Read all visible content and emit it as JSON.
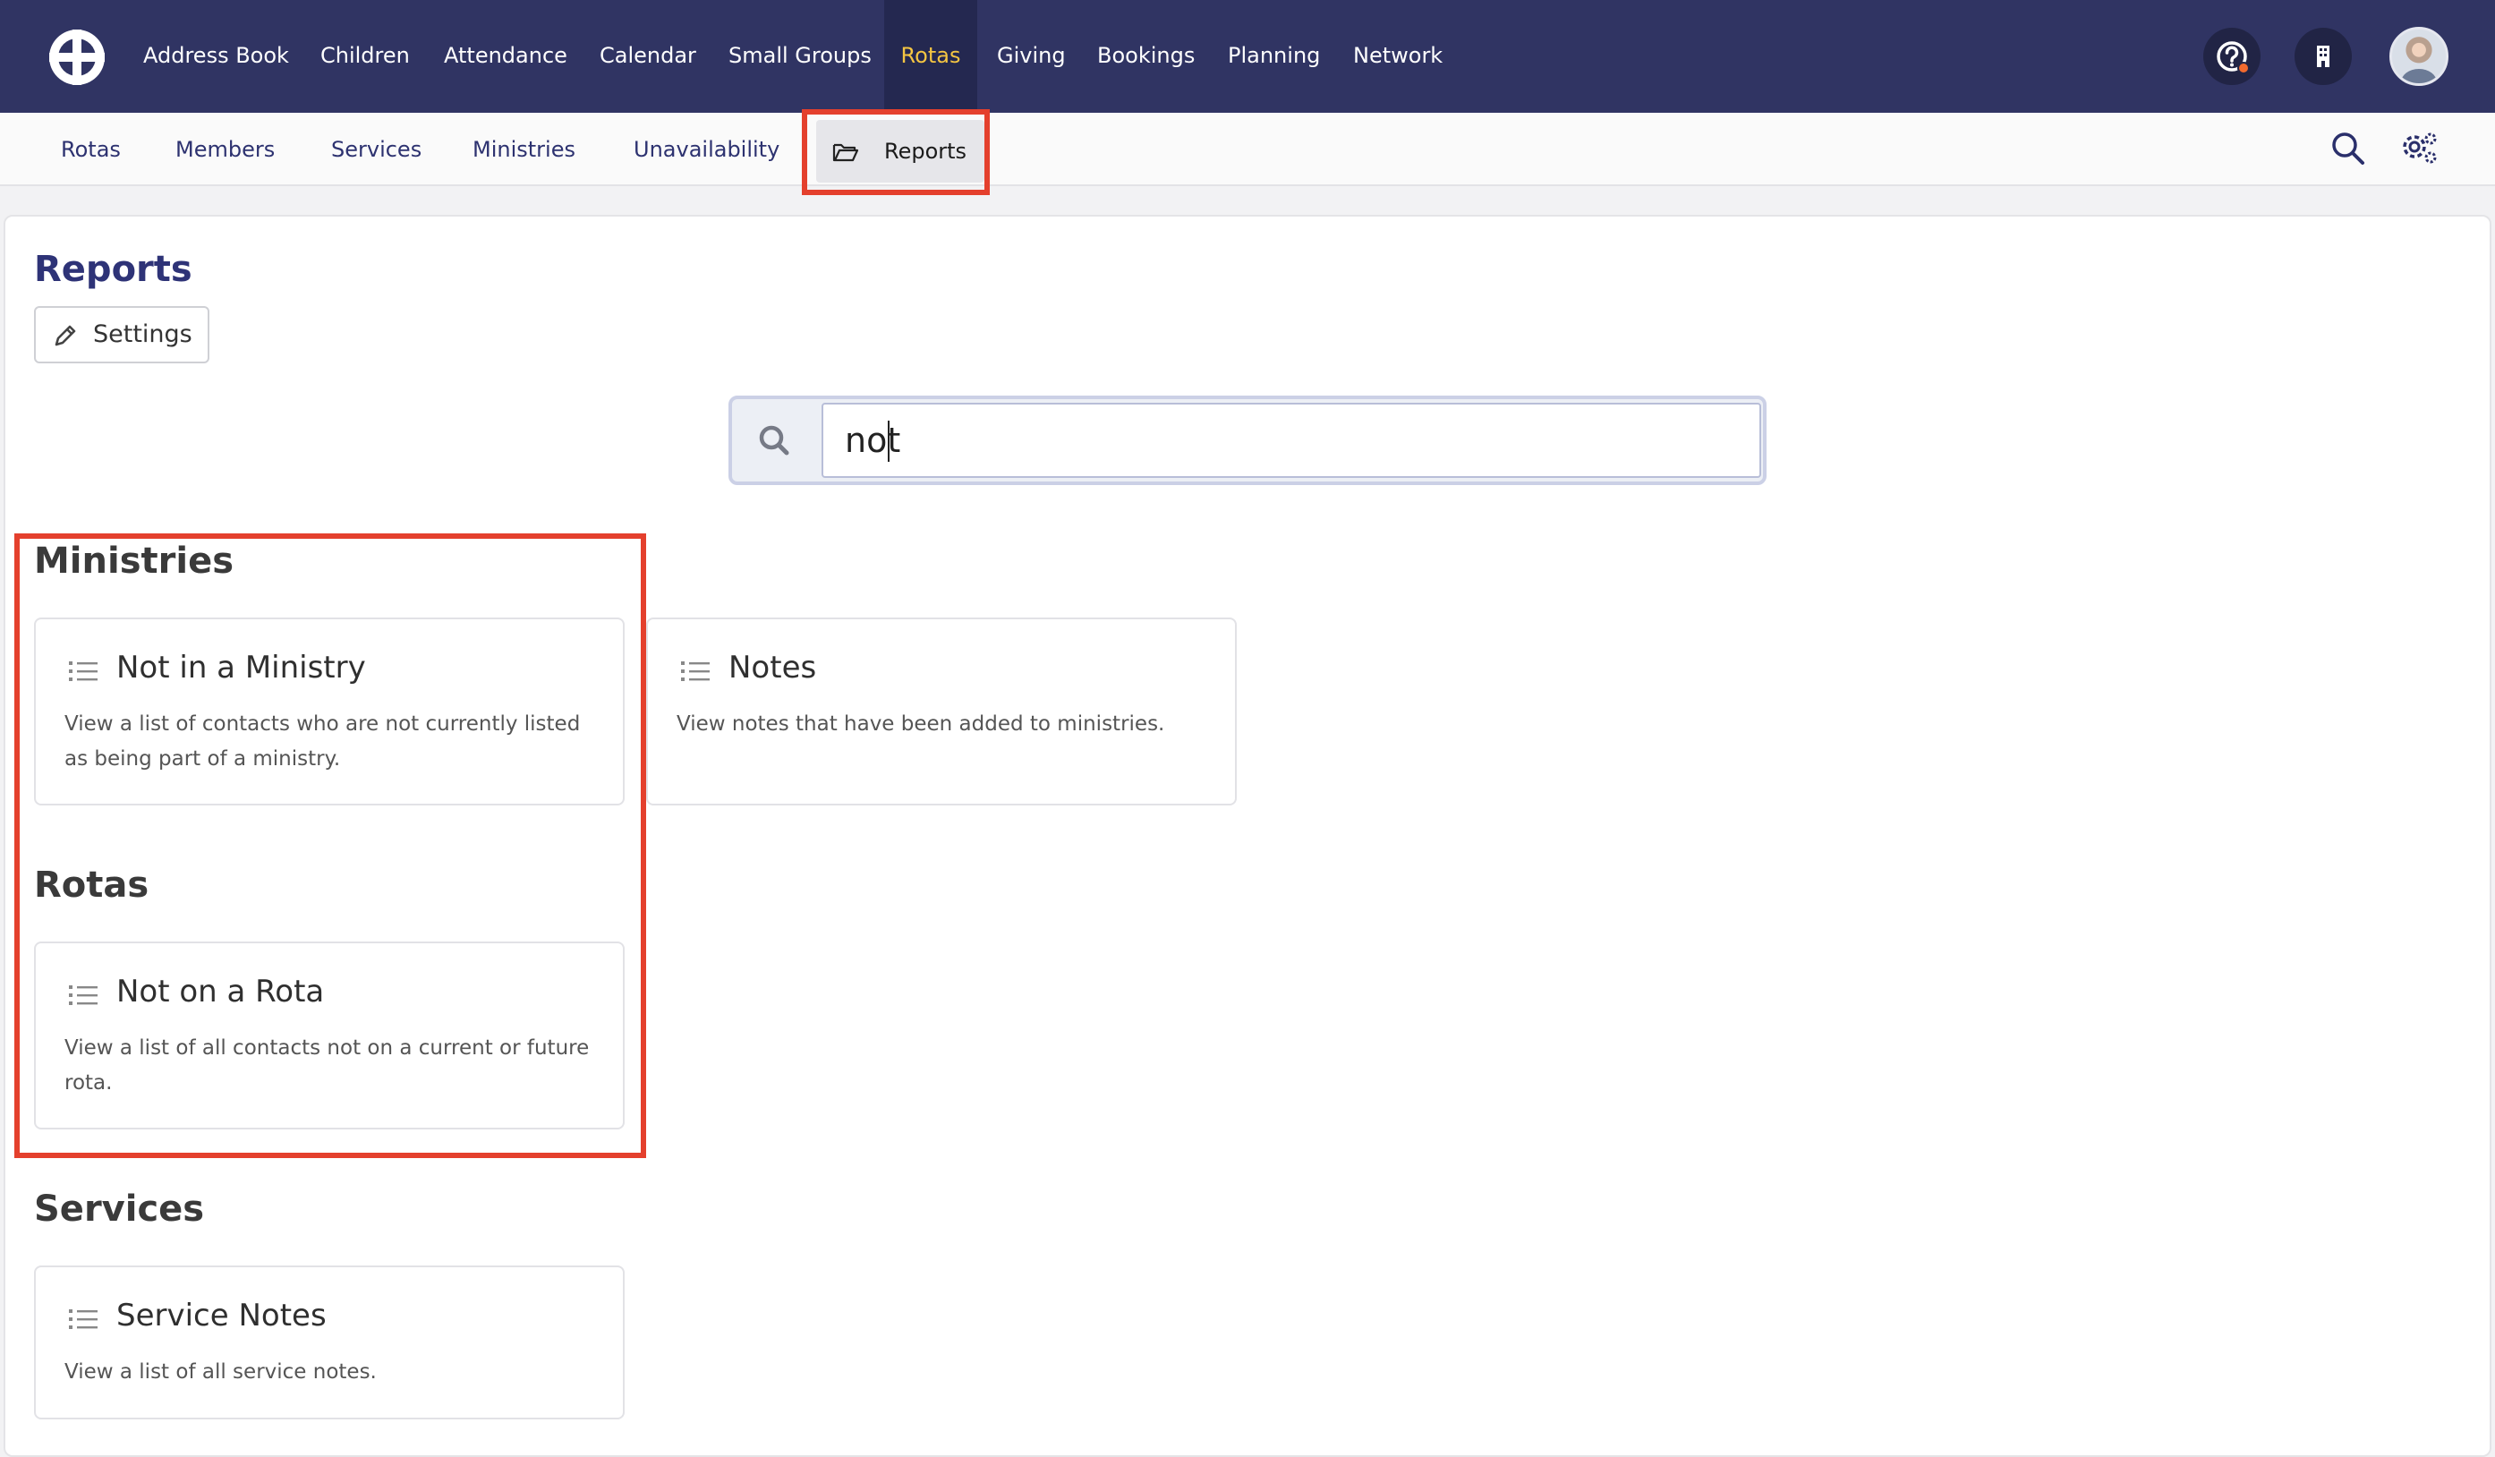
{
  "topnav": {
    "items": [
      {
        "label": "Address Book"
      },
      {
        "label": "Children"
      },
      {
        "label": "Attendance"
      },
      {
        "label": "Calendar"
      },
      {
        "label": "Small Groups"
      },
      {
        "label": "Rotas"
      },
      {
        "label": "Giving"
      },
      {
        "label": "Bookings"
      },
      {
        "label": "Planning"
      },
      {
        "label": "Network"
      }
    ],
    "active": "Rotas",
    "active_color": "#f4c542",
    "background": "#303463",
    "icons": [
      "app-logo-icon",
      "help-icon",
      "building-icon",
      "user-avatar"
    ]
  },
  "subnav": {
    "items": [
      {
        "label": "Rotas"
      },
      {
        "label": "Members"
      },
      {
        "label": "Services"
      },
      {
        "label": "Ministries"
      },
      {
        "label": "Unavailability"
      },
      {
        "label": "Reports"
      }
    ],
    "active": "Reports",
    "right_icons": [
      "search-icon",
      "settings-gear-icon"
    ]
  },
  "page": {
    "title": "Reports",
    "settings_label": "Settings"
  },
  "search": {
    "value": "not"
  },
  "sections": [
    {
      "title": "Ministries",
      "cards": [
        {
          "title": "Not in a Ministry",
          "description": "View a list of contacts who are not currently listed as being part of a ministry."
        },
        {
          "title": "Notes",
          "description": "View notes that have been added to ministries."
        }
      ]
    },
    {
      "title": "Rotas",
      "cards": [
        {
          "title": "Not on a Rota",
          "description": "View a list of all contacts not on a current or future rota."
        }
      ]
    },
    {
      "title": "Services",
      "cards": [
        {
          "title": "Service Notes",
          "description": "View a list of all service notes."
        }
      ]
    }
  ],
  "highlight_color": "#e4402d"
}
